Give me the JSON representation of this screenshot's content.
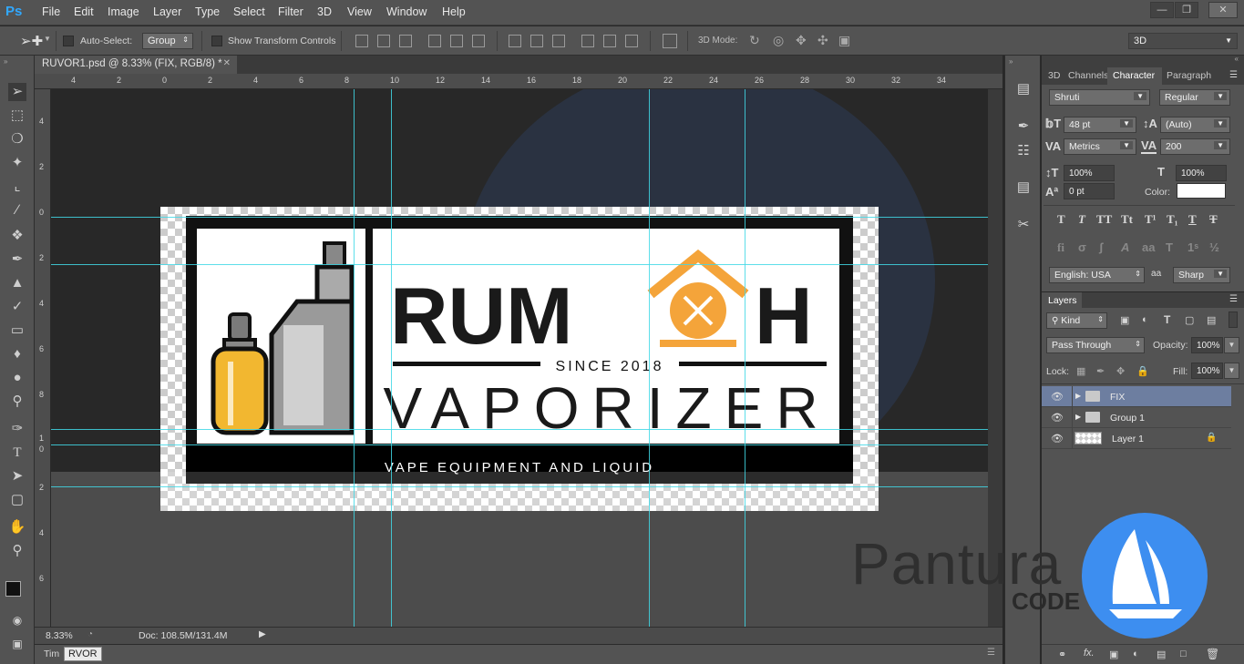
{
  "app": {
    "logo": "Ps"
  },
  "menu": [
    "File",
    "Edit",
    "Image",
    "Layer",
    "Type",
    "Select",
    "Filter",
    "3D",
    "View",
    "Window",
    "Help"
  ],
  "options": {
    "auto_select_label": "Auto-Select:",
    "auto_select_value": "Group",
    "show_transform_label": "Show Transform Controls",
    "mode_3d_label": "3D Mode:",
    "workspace": "3D"
  },
  "document": {
    "tab_title": "RUVOR1.psd @ 8.33% (FIX, RGB/8) *",
    "zoom": "8.33%",
    "doc_size": "Doc: 108.5M/131.4M"
  },
  "ruler": {
    "top": [
      "4",
      "2",
      "0",
      "2",
      "4",
      "6",
      "8",
      "10",
      "12",
      "14",
      "16",
      "18",
      "20",
      "22",
      "24",
      "26",
      "28",
      "30",
      "32",
      "34"
    ],
    "left": [
      "4",
      "2",
      "0",
      "2",
      "4",
      "6",
      "8",
      "1",
      "0",
      "2",
      "4",
      "6"
    ]
  },
  "artwork": {
    "word1_a": "RUM",
    "word1_b": "H",
    "since": "SINCE 2018",
    "word2": "VAPORIZER",
    "tagline": "VAPE EQUIPMENT AND LIQUID"
  },
  "panel_tabs": [
    "3D",
    "Channels",
    "Character",
    "Paragraph"
  ],
  "character": {
    "font": "Shruti",
    "style": "Regular",
    "size": "48 pt",
    "leading": "(Auto)",
    "kerning": "Metrics",
    "tracking": "200",
    "vscale": "100%",
    "hscale": "100%",
    "baseline": "0 pt",
    "color_label": "Color:",
    "color": "#ffffff",
    "language": "English: USA",
    "aa_label": "a",
    "antialias": "Sharp"
  },
  "layers": {
    "title": "Layers",
    "kind": "Kind",
    "blend": "Pass Through",
    "opacity_label": "Opacity:",
    "opacity": "100%",
    "lock_label": "Lock:",
    "fill_label": "Fill:",
    "fill": "100%",
    "items": [
      {
        "name": "FIX",
        "type": "group",
        "selected": true
      },
      {
        "name": "Group 1",
        "type": "group",
        "selected": false
      },
      {
        "name": "Layer 1",
        "type": "layer",
        "selected": false
      }
    ]
  },
  "timeline_label": "Tim",
  "tooltip": "RVOR",
  "watermark": {
    "name": "Pantura",
    "sub": "CODE"
  }
}
